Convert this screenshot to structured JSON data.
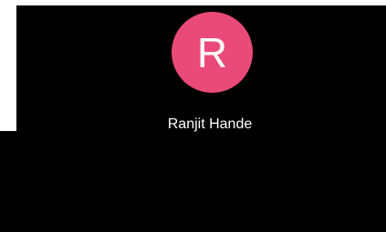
{
  "contact": {
    "initial": "R",
    "name": "Ranjit Hande",
    "avatar_color": "#e94a7a"
  },
  "colors": {
    "background": "#000000",
    "margin": "#ffffff",
    "text": "#ffffff"
  }
}
